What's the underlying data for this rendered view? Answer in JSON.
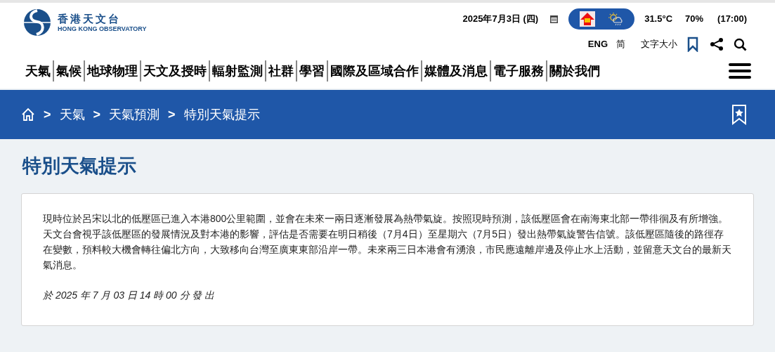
{
  "logo": {
    "name_zh": "香港天文台",
    "name_en": "HONG KONG OBSERVATORY"
  },
  "top_bar": {
    "date": "2025年7月3日 (四)",
    "temperature": "31.5°C",
    "humidity": "70%",
    "time": "(17:00)"
  },
  "utility_links": [
    {
      "label": "ENG"
    },
    {
      "label": "简"
    },
    {
      "label": "文字大小"
    }
  ],
  "nav": [
    {
      "label": "天氣"
    },
    {
      "label": "氣候"
    },
    {
      "label": "地球物理"
    },
    {
      "label": "天文及授時"
    },
    {
      "label": "輻射監測"
    },
    {
      "label": "社群"
    },
    {
      "label": "學習"
    },
    {
      "label": "國際及區域合作"
    },
    {
      "label": "媒體及消息"
    },
    {
      "label": "電子服務"
    },
    {
      "label": "關於我們"
    }
  ],
  "breadcrumb": [
    {
      "label": "天氣"
    },
    {
      "label": "天氣預測"
    },
    {
      "label": "特別天氣提示"
    }
  ],
  "breadcrumb_separator": ">",
  "page_title": "特別天氣提示",
  "notice": {
    "body": "現時位於呂宋以北的低壓區已進入本港800公里範圍，並會在未來一兩日逐漸發展為熱帶氣旋。按照現時預測，該低壓區會在南海東北部一帶徘徊及有所增強。天文台會視乎該低壓區的發展情況及對本港的影響，評估是否需要在明日稍後（7月4日）至星期六（7月5日）發出熱帶氣旋警告信號。該低壓區隨後的路徑存在變數，預料較大機會轉往偏北方向，大致移向台灣至廣東東部沿岸一帶。未來兩三日本港會有湧浪，市民應遠離岸邊及停止水上活動，並留意天文台的最新天氣消息。",
    "issued": "於 2025 年 7 月 03 日 14 時 00 分 發 出"
  }
}
